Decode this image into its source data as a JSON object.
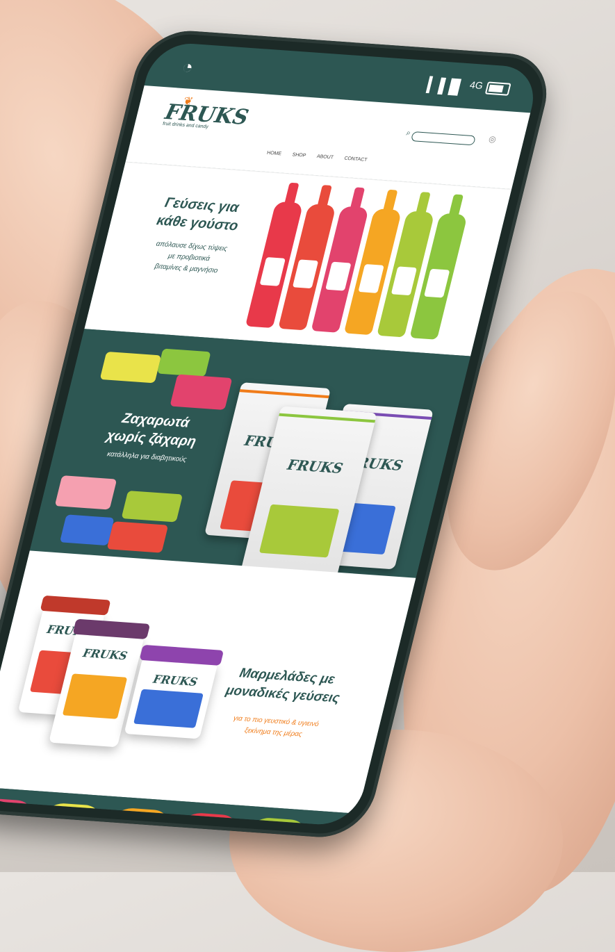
{
  "status": {
    "network": "4G"
  },
  "header": {
    "logo": "FRUKS",
    "logo_tagline": "fruit drinks and candy",
    "search_placeholder": "",
    "nav": [
      "HOME",
      "SHOP",
      "ABOUT",
      "CONTACT"
    ]
  },
  "section_drinks": {
    "title_line1": "Γεύσεις για",
    "title_line2": "κάθε γούστο",
    "sub_line1": "απόλαυσε δίχως τύψεις",
    "sub_line2": "με προβιοτικά",
    "sub_line3": "βιταμίνες & μαγνήσιο",
    "bottle_colors": [
      "#e8394a",
      "#e94b3c",
      "#e2436d",
      "#f5a623",
      "#a8c93a",
      "#8cc63f"
    ]
  },
  "section_candy": {
    "title_line1": "Ζαχαρωτά",
    "title_line2": "χωρίς ζάχαρη",
    "sub": "κατάλληλα για διαβητικούς",
    "pouch_brand": "FRUKS"
  },
  "section_jams": {
    "title_line1": "Μαρμελάδες με",
    "title_line2": "μοναδικές γεύσεις",
    "sub_line1": "για το πιο γευστικό & υγιεινό",
    "sub_line2": "ξεκίνημα της μέρας",
    "jar_brand": "FRUKS"
  },
  "colors": {
    "brand_green": "#2d5753",
    "accent_orange": "#f07c1a"
  }
}
